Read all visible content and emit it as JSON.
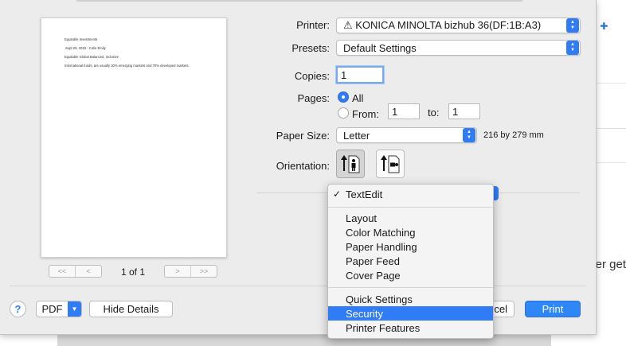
{
  "background": {
    "partial_text": "er get",
    "toolbar_icons": [
      "format-icon",
      "grid-icon"
    ]
  },
  "preview": {
    "lines": [
      "Equitable Investments",
      "Sept 29, 2015 - Colin Emily",
      "Equitable Global Balanced, Inclusive",
      "International funds, are usually 30% emerging markets and 70% developed markets."
    ],
    "page_count": "1 of 1",
    "nav": [
      "<<",
      "<",
      ">",
      ">>"
    ]
  },
  "form": {
    "printer_label": "Printer:",
    "printer_value": "⚠ KONICA MINOLTA bizhub 36(DF:1B:A3)",
    "presets_label": "Presets:",
    "presets_value": "Default Settings",
    "copies_label": "Copies:",
    "copies_value": "1",
    "pages_label": "Pages:",
    "pages_all": "All",
    "pages_from": "From:",
    "from_value": "1",
    "to_label": "to:",
    "to_value": "1",
    "paper_size_label": "Paper Size:",
    "paper_size_value": "Letter",
    "paper_dims": "216 by 279 mm",
    "orientation_label": "Orientation:"
  },
  "menu": {
    "checked_item": "TextEdit",
    "group1": [
      "Layout",
      "Color Matching",
      "Paper Handling",
      "Paper Feed",
      "Cover Page"
    ],
    "group2": [
      "Quick Settings",
      "Security",
      "Printer Features"
    ],
    "highlighted": "Security"
  },
  "bottom": {
    "help": "?",
    "pdf": "PDF",
    "hide_details": "Hide Details",
    "cancel_partial": "cel",
    "print": "Print"
  },
  "colors": {
    "accent": "#2f7cf6",
    "sheet_bg": "#ececec"
  }
}
